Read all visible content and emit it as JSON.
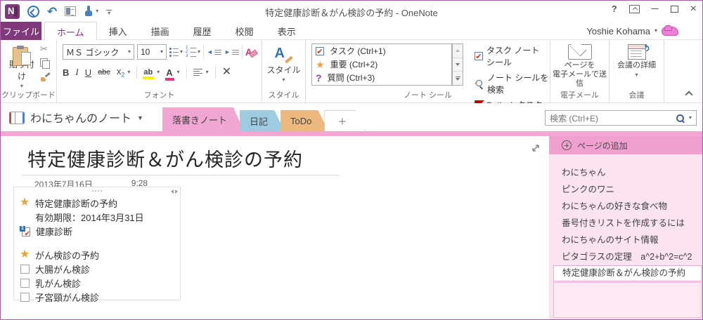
{
  "icons": {
    "caret_down": "▾",
    "caret_down_big": "▼",
    "undo_glyph": "↶",
    "cut_glyph": "✂",
    "help_glyph": "?",
    "minimize_glyph": "—",
    "close_glyph": "×",
    "check_glyph": "✔",
    "star_glyph": "★",
    "question_glyph": "?",
    "qat_more_glyph": "⌄",
    "outdent_glyph": "◄",
    "indent_glyph": "►",
    "one_glyph": "1",
    "num123": "123"
  },
  "titlebar": {
    "title": "特定健康診断＆がん検診の予約 - OneNote",
    "user_name": "Yoshie Kohama"
  },
  "ribbon_tabs": {
    "file": "ファイル",
    "home": "ホーム",
    "insert": "挿入",
    "draw": "描画",
    "history": "履歴",
    "review": "校閲",
    "view": "表示"
  },
  "clipboard": {
    "paste_label": "貼り付け",
    "group_label": "クリップボード"
  },
  "font": {
    "font_name": "ＭＳ ゴシック",
    "font_size": "10",
    "bold": "B",
    "italic": "I",
    "underline": "U",
    "strike": "abc",
    "subscript_base": "x",
    "subscript_sub": "2",
    "highlight": "ab",
    "font_color": "A",
    "delete_x": "✕",
    "group_label": "フォント"
  },
  "styles": {
    "letter": "A",
    "button_label": "スタイル",
    "group_label": "スタイル"
  },
  "tags": {
    "items": [
      {
        "label": "タスク (Ctrl+1)",
        "icon": "task-check"
      },
      {
        "label": "重要 (Ctrl+2)",
        "icon": "important-star"
      },
      {
        "label": "質問 (Ctrl+3)",
        "icon": "question-mark"
      }
    ],
    "task_seal": "タスク ノート シール",
    "find_seals": "ノート シールを検索",
    "outlook_task": "Outlook タスク",
    "group_label": "ノート シール"
  },
  "email": {
    "line1": "ページを",
    "line2": "電子メールで送信",
    "group_label": "電子メール"
  },
  "meeting": {
    "button_label": "会議の詳細",
    "group_label": "会議"
  },
  "navbar": {
    "notebook_name": "わにちゃんのノート",
    "sections": [
      {
        "label": "落書きノート",
        "color": "#F2A7D3",
        "active": true
      },
      {
        "label": "日記",
        "color": "#9DCBE0",
        "active": false
      },
      {
        "label": "ToDo",
        "color": "#EDB87D",
        "active": false
      }
    ],
    "add_section": "＋",
    "search_placeholder": "検索 (Ctrl+E)"
  },
  "page": {
    "title": "特定健康診断＆がん検診の予約",
    "date": "2013年7月16日",
    "time": "9:28",
    "note_lines": [
      {
        "icon": "star-tag",
        "text": "特定健康診断の予約"
      },
      {
        "icon": "none",
        "text": "有効期限：2014年3月31日"
      },
      {
        "icon": "outlook-task",
        "text": "健康診断"
      },
      {
        "icon": "blank",
        "text": ""
      },
      {
        "icon": "star-tag",
        "text": "がん検診の予約"
      },
      {
        "icon": "checkbox",
        "text": "大腸がん検診"
      },
      {
        "icon": "checkbox",
        "text": "乳がん検診"
      },
      {
        "icon": "checkbox",
        "text": "子宮頸がん検診"
      }
    ]
  },
  "sidebar": {
    "add_page": "ページの追加",
    "pages": [
      "わにちゃん",
      "ピンクのワニ",
      "わにちゃんの好きな食べ物",
      "番号付きリストを作成するには",
      "わにちゃんのサイト情報",
      "ピタゴラスの定理　a^2+b^2=c^2",
      "特定健康診断＆がん検診の予約"
    ],
    "selected_index": 6
  },
  "colors": {
    "accent_purple": "#80397B",
    "accent_pink": "#F2A7D3",
    "sidebar_header_pink": "#EFA0CE",
    "sidebar_bg_pink": "#FBE3F1",
    "section_blue": "#9DCBE0",
    "section_orange": "#EDB87D"
  }
}
